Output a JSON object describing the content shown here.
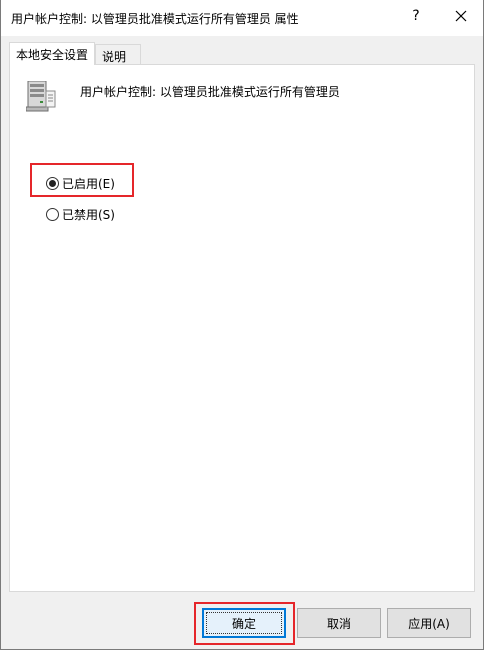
{
  "window": {
    "title": "用户帐户控制: 以管理员批准模式运行所有管理员 属性",
    "help_label": "?",
    "close_icon": "close-icon"
  },
  "tabs": [
    {
      "label": "本地安全设置",
      "active": true
    },
    {
      "label": "说明",
      "active": false
    }
  ],
  "policy": {
    "icon": "server-policy-icon",
    "name": "用户帐户控制: 以管理员批准模式运行所有管理员"
  },
  "options": {
    "enabled": {
      "label": "已启用(E)",
      "selected": true
    },
    "disabled": {
      "label": "已禁用(S)",
      "selected": false
    }
  },
  "buttons": {
    "ok": "确定",
    "cancel": "取消",
    "apply": "应用(A)"
  },
  "colors": {
    "highlight": "#e5262a",
    "default_button_border": "#0078d7"
  }
}
